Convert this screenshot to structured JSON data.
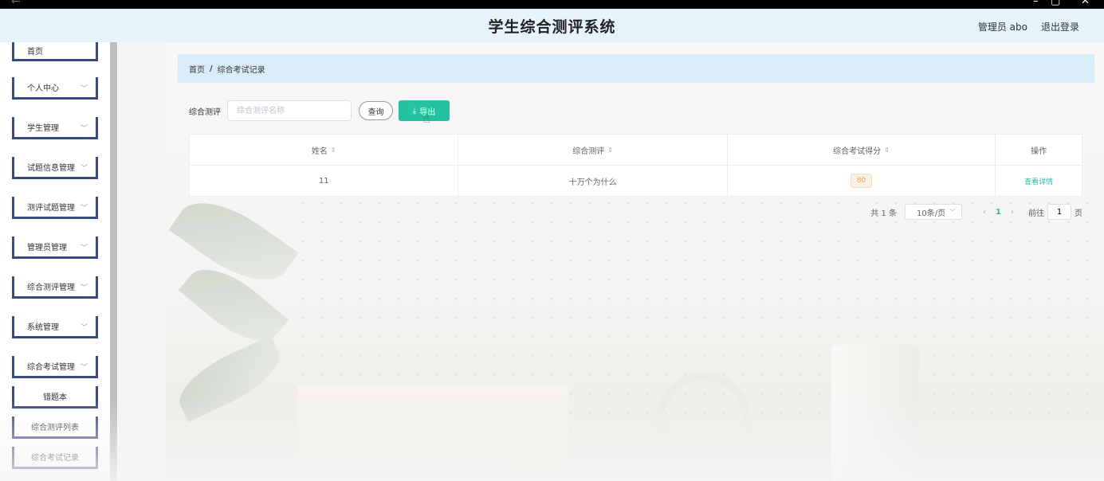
{
  "app": {
    "title": "学生综合测评系统",
    "user_label": "管理员 abo",
    "logout_label": "退出登录"
  },
  "window": {
    "back_glyph": "←",
    "minimize_glyph": "–",
    "maximize_glyph": "▢",
    "close_glyph": "✕"
  },
  "sidebar": {
    "items": [
      {
        "label": "首页",
        "expandable": false
      },
      {
        "label": "个人中心",
        "expandable": true
      },
      {
        "label": "学生管理",
        "expandable": true
      },
      {
        "label": "试题信息管理",
        "expandable": true
      },
      {
        "label": "测评试题管理",
        "expandable": true
      },
      {
        "label": "管理员管理",
        "expandable": true
      },
      {
        "label": "综合测评管理",
        "expandable": true
      },
      {
        "label": "系统管理",
        "expandable": true
      },
      {
        "label": "综合考试管理",
        "expandable": true
      }
    ],
    "sub_items": [
      {
        "label": "错题本"
      },
      {
        "label": "综合测评列表"
      },
      {
        "label": "综合考试记录"
      }
    ]
  },
  "breadcrumb": {
    "home": "首页",
    "separator": "/",
    "current": "综合考试记录"
  },
  "search": {
    "label": "综合测评",
    "placeholder": "综合测评名称",
    "value": "",
    "query_button": "查询",
    "export_button": "导出"
  },
  "table": {
    "columns": [
      {
        "label": "姓名",
        "sortable": true
      },
      {
        "label": "综合测评",
        "sortable": true
      },
      {
        "label": "综合考试得分",
        "sortable": true
      },
      {
        "label": "操作",
        "sortable": false
      }
    ],
    "rows": [
      {
        "name": "11",
        "evaluation": "十万个为什么",
        "score": "80",
        "action": "查看详情"
      }
    ]
  },
  "pagination": {
    "total": "共 1 条",
    "page_size": "10条/页",
    "current_page": "1",
    "goto_prefix": "前往",
    "goto_value": "1",
    "goto_suffix": "页"
  },
  "colors": {
    "accent": "#25c2a0",
    "header_bg": "#e6f3fb",
    "breadcrumb_bg": "#d9edf8",
    "score_badge": "#f0a24e"
  }
}
